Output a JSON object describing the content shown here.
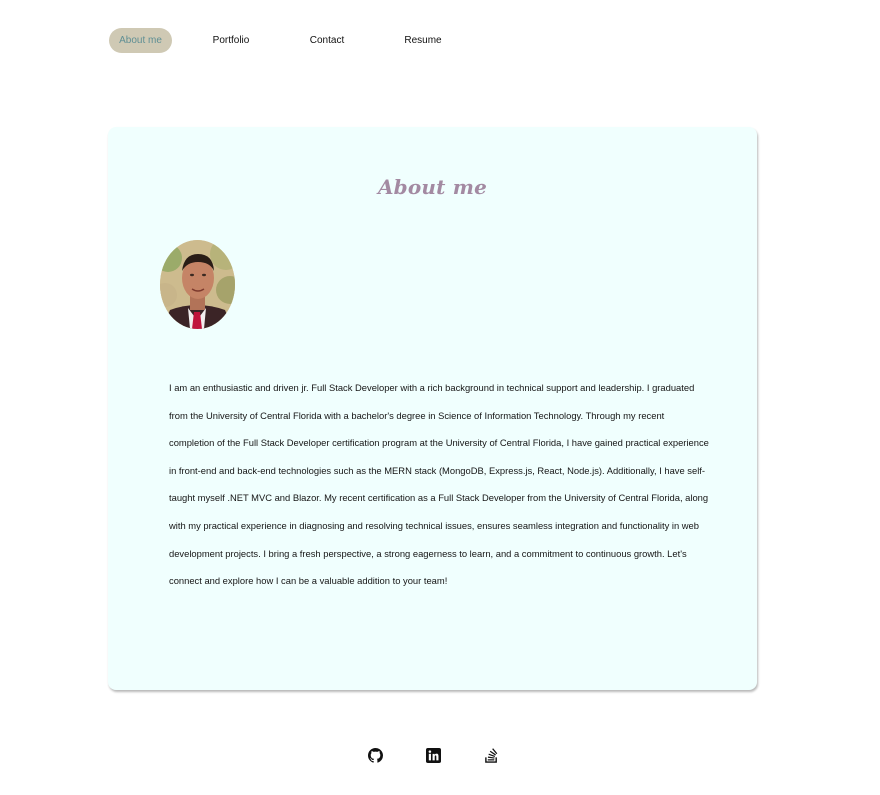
{
  "nav": {
    "items": [
      {
        "label": "About me",
        "active": true
      },
      {
        "label": "Portfolio",
        "active": false
      },
      {
        "label": "Contact",
        "active": false
      },
      {
        "label": "Resume",
        "active": false
      }
    ]
  },
  "about": {
    "title": "About me",
    "bio": "I am an enthusiastic and driven jr. Full Stack Developer with a rich background in technical support and leadership. I graduated from the University of Central Florida with a bachelor's degree in Science of Information Technology. Through my recent completion of the Full Stack Developer certification program at the University of Central Florida, I have gained practical experience in front-end and back-end technologies such as the MERN stack (MongoDB, Express.js, React, Node.js). Additionally, I have self-taught myself .NET MVC and Blazor. My recent certification as a Full Stack Developer from the University of Central Florida, along with my practical experience in diagnosing and resolving technical issues, ensures seamless integration and functionality in web development projects. I bring a fresh perspective, a strong eagerness to learn, and a commitment to continuous growth. Let's connect and explore how I can be a valuable addition to your team!"
  },
  "footer": {
    "icons": [
      "github-icon",
      "linkedin-icon",
      "stackoverflow-icon"
    ]
  },
  "colors": {
    "nav_active_bg": "#cfc9b4",
    "nav_active_text": "#5f8f94",
    "card_bg": "#f0fffe",
    "title": "#a38aa2"
  }
}
